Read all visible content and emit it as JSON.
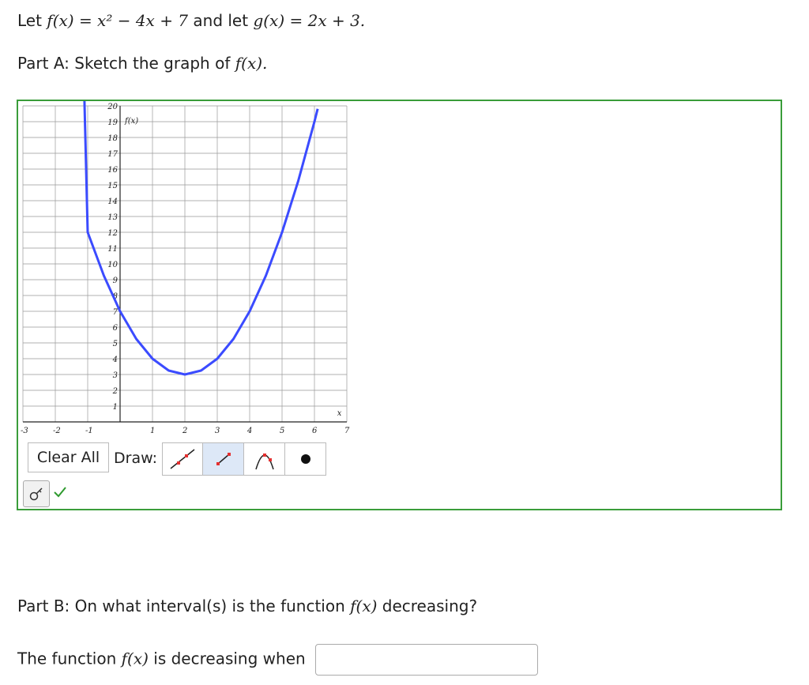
{
  "question": {
    "let1": "Let",
    "f_def": "f(x) = x² − 4x + 7",
    "and_let": "and let",
    "g_def": "g(x) = 2x + 3."
  },
  "part_a": {
    "prefix": "Part A: Sketch the graph of",
    "fx": "f(x).",
    "graph": {
      "y_axis_label": "f(x)",
      "x_axis_label": "x",
      "x_range": [
        -3,
        7
      ],
      "y_range": [
        0,
        20
      ],
      "x_tick_labels": [
        "-3",
        "-2",
        "-1",
        "1",
        "2",
        "3",
        "4",
        "5",
        "6",
        "7"
      ],
      "y_tick_labels": [
        "1",
        "2",
        "3",
        "4",
        "5",
        "6",
        "7",
        "8",
        "9",
        "10",
        "11",
        "12",
        "13",
        "14",
        "15",
        "16",
        "17",
        "18",
        "19",
        "20"
      ],
      "curve_color": "#3b4bff",
      "grid_color": "#999999",
      "border_color": "#3a9d3a"
    },
    "toolbar": {
      "clear_label": "Clear All",
      "draw_label": "Draw:",
      "tools": [
        "line-tool-icon",
        "segment-tool-icon",
        "parabola-tool-icon",
        "point-tool-icon"
      ],
      "active_tool": "segment-tool-icon"
    }
  },
  "part_b": {
    "prefix": "Part B: On what interval(s) is the function",
    "fx": "f(x)",
    "suffix": "decreasing?",
    "answer_prefix": "The function",
    "answer_fx": "f(x)",
    "answer_suffix": "is decreasing when",
    "answer_value": ""
  },
  "chart_data": {
    "type": "line",
    "title": "",
    "xlabel": "x",
    "ylabel": "f(x)",
    "xlim": [
      -3,
      7
    ],
    "ylim": [
      0,
      20
    ],
    "grid": true,
    "series": [
      {
        "name": "f(x)",
        "function": "x^2 - 4x + 7",
        "x": [
          -1.1,
          -1,
          -0.5,
          0,
          0.5,
          1,
          1.5,
          2,
          2.5,
          3,
          3.5,
          4,
          4.5,
          5,
          5.5,
          6,
          6.1
        ],
        "y": [
          20.61,
          12,
          9.25,
          7,
          5.25,
          4,
          3.25,
          3,
          3.25,
          4,
          5.25,
          7,
          9.25,
          12,
          15.25,
          19,
          19.81
        ]
      }
    ]
  }
}
